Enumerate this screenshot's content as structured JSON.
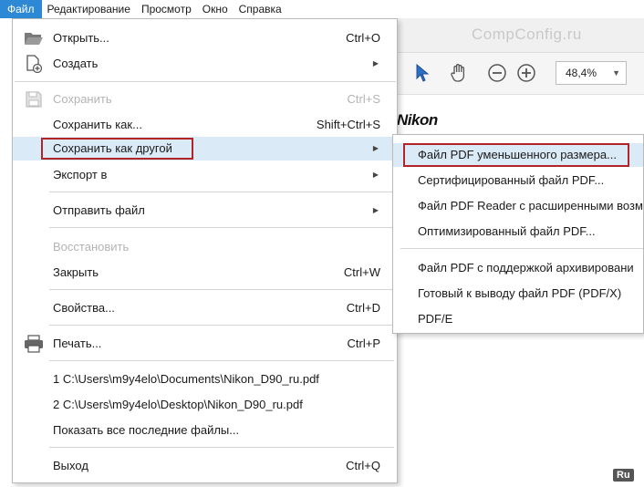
{
  "menubar": {
    "items": [
      "Файл",
      "Редактирование",
      "Просмотр",
      "Окно",
      "Справка"
    ]
  },
  "background": {
    "watermark": "CompConfig.ru",
    "zoom_value": "48,4%",
    "document_logo": "Nikon",
    "badge": "Ru"
  },
  "file_menu": {
    "open": {
      "label": "Открыть...",
      "shortcut": "Ctrl+O"
    },
    "create": {
      "label": "Создать"
    },
    "save": {
      "label": "Сохранить",
      "shortcut": "Ctrl+S"
    },
    "save_as": {
      "label": "Сохранить как...",
      "shortcut": "Shift+Ctrl+S"
    },
    "save_as_other": {
      "label": "Сохранить как другой"
    },
    "export": {
      "label": "Экспорт в"
    },
    "send": {
      "label": "Отправить файл"
    },
    "restore": {
      "label": "Восстановить"
    },
    "close": {
      "label": "Закрыть",
      "shortcut": "Ctrl+W"
    },
    "properties": {
      "label": "Свойства...",
      "shortcut": "Ctrl+D"
    },
    "print": {
      "label": "Печать...",
      "shortcut": "Ctrl+P"
    },
    "recent1": {
      "label": "1 C:\\Users\\m9y4elo\\Documents\\Nikon_D90_ru.pdf"
    },
    "recent2": {
      "label": "2 C:\\Users\\m9y4elo\\Desktop\\Nikon_D90_ru.pdf"
    },
    "show_recent": {
      "label": "Показать все последние файлы..."
    },
    "exit": {
      "label": "Выход",
      "shortcut": "Ctrl+Q"
    }
  },
  "submenu": {
    "items": [
      "Файл PDF уменьшенного размера...",
      "Сертифицированный файл PDF...",
      "Файл PDF Reader с расширенными возм",
      "Оптимизированный файл PDF...",
      "Файл PDF с поддержкой архивировани",
      "Готовый к выводу файл PDF (PDF/X)",
      "PDF/E"
    ]
  },
  "colors": {
    "menubar_active": "#2d89d6",
    "hover": "#dbeaf7",
    "annotation": "#b3242a",
    "disabled_text": "#b4b4b4"
  }
}
